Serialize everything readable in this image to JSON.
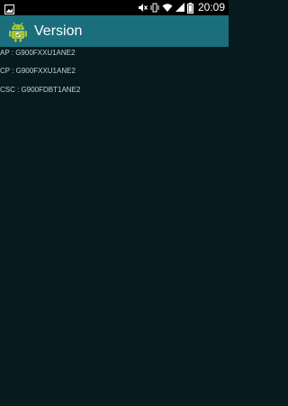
{
  "status_bar": {
    "time": "20:09",
    "icons": [
      "screenshot-icon",
      "mute-icon",
      "vibrate-icon",
      "wifi-icon",
      "signal-icon",
      "battery-icon"
    ]
  },
  "action_bar": {
    "title": "Version",
    "app_icon": "android-icon",
    "color": "#1b6e7c"
  },
  "versions": [
    {
      "label": "AP",
      "value": "G900FXXU1ANE2",
      "text": "AP : G900FXXU1ANE2"
    },
    {
      "label": "CP",
      "value": "G900FXXU1ANE2",
      "text": "CP : G900FXXU1ANE2"
    },
    {
      "label": "CSC",
      "value": "G900FDBT1ANE2",
      "text": "CSC : G900FDBT1ANE2"
    }
  ],
  "colors": {
    "background": "#051b20",
    "status_bar": "#000000",
    "text": "#c9d3d6"
  }
}
